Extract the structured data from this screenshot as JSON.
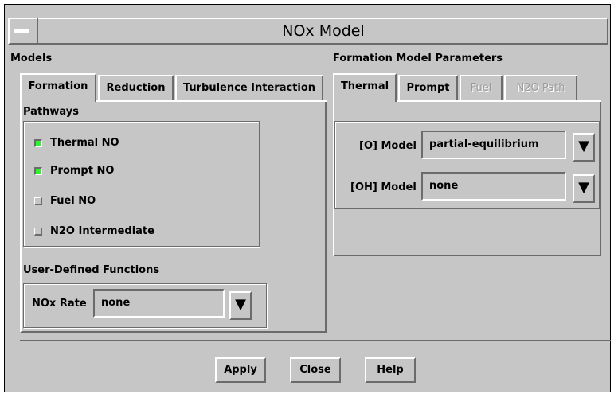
{
  "window": {
    "title": "NOx Model"
  },
  "models": {
    "heading": "Models",
    "tabs": [
      {
        "label": "Formation",
        "active": true
      },
      {
        "label": "Reduction",
        "active": false
      },
      {
        "label": "Turbulence Interaction",
        "active": false
      }
    ],
    "pathways": {
      "heading": "Pathways",
      "items": [
        {
          "label": "Thermal NO",
          "checked": true
        },
        {
          "label": "Prompt NO",
          "checked": true
        },
        {
          "label": "Fuel NO",
          "checked": false
        },
        {
          "label": "N2O Intermediate",
          "checked": false
        }
      ]
    },
    "udf": {
      "heading": "User-Defined Functions",
      "nox_rate_label": "NOx Rate",
      "nox_rate_value": "none"
    }
  },
  "formation_params": {
    "heading": "Formation Model Parameters",
    "tabs": [
      {
        "label": "Thermal",
        "active": true,
        "enabled": true
      },
      {
        "label": "Prompt",
        "active": false,
        "enabled": true
      },
      {
        "label": "Fuel",
        "active": false,
        "enabled": false
      },
      {
        "label": "N2O Path",
        "active": false,
        "enabled": false
      }
    ],
    "o_model_label": "[O] Model",
    "o_model_value": "partial-equilibrium",
    "oh_model_label": "[OH] Model",
    "oh_model_value": "none"
  },
  "buttons": {
    "apply": "Apply",
    "close": "Close",
    "help": "Help"
  },
  "colors": {
    "background": "#c6c6c6",
    "check_on": "#2cf52c",
    "highlight": "#ffffff",
    "shadow": "#6b6b6b"
  },
  "icons": {
    "window_menu": "window-menu-icon",
    "dropdown": "triangle-down-icon"
  }
}
